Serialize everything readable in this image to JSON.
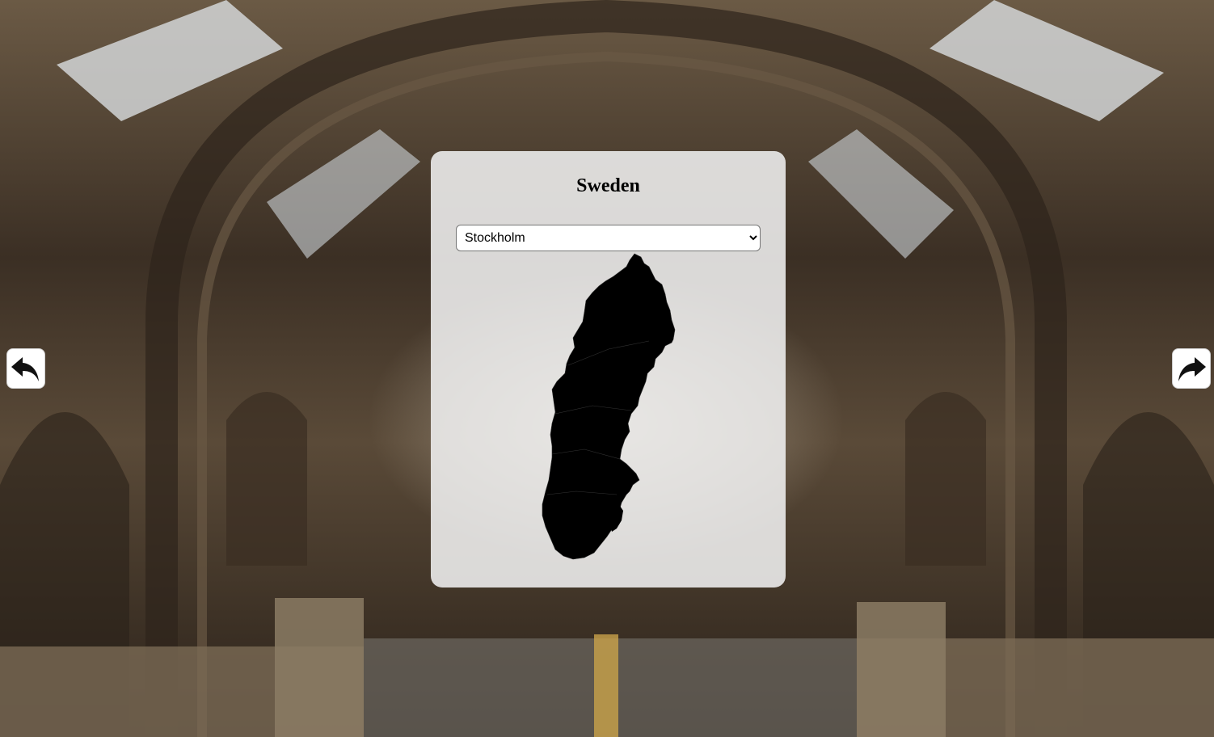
{
  "page": {
    "title": "Sweden"
  },
  "region_select": {
    "selected": "Stockholm",
    "options": [
      "Stockholm"
    ]
  },
  "map": {
    "country": "Sweden",
    "fill_color": "#000000",
    "border_color": "#333333"
  },
  "navigation": {
    "back_icon": "arrow-back-icon",
    "forward_icon": "arrow-forward-icon"
  },
  "background": {
    "description_icon": "museum-hall-background"
  }
}
